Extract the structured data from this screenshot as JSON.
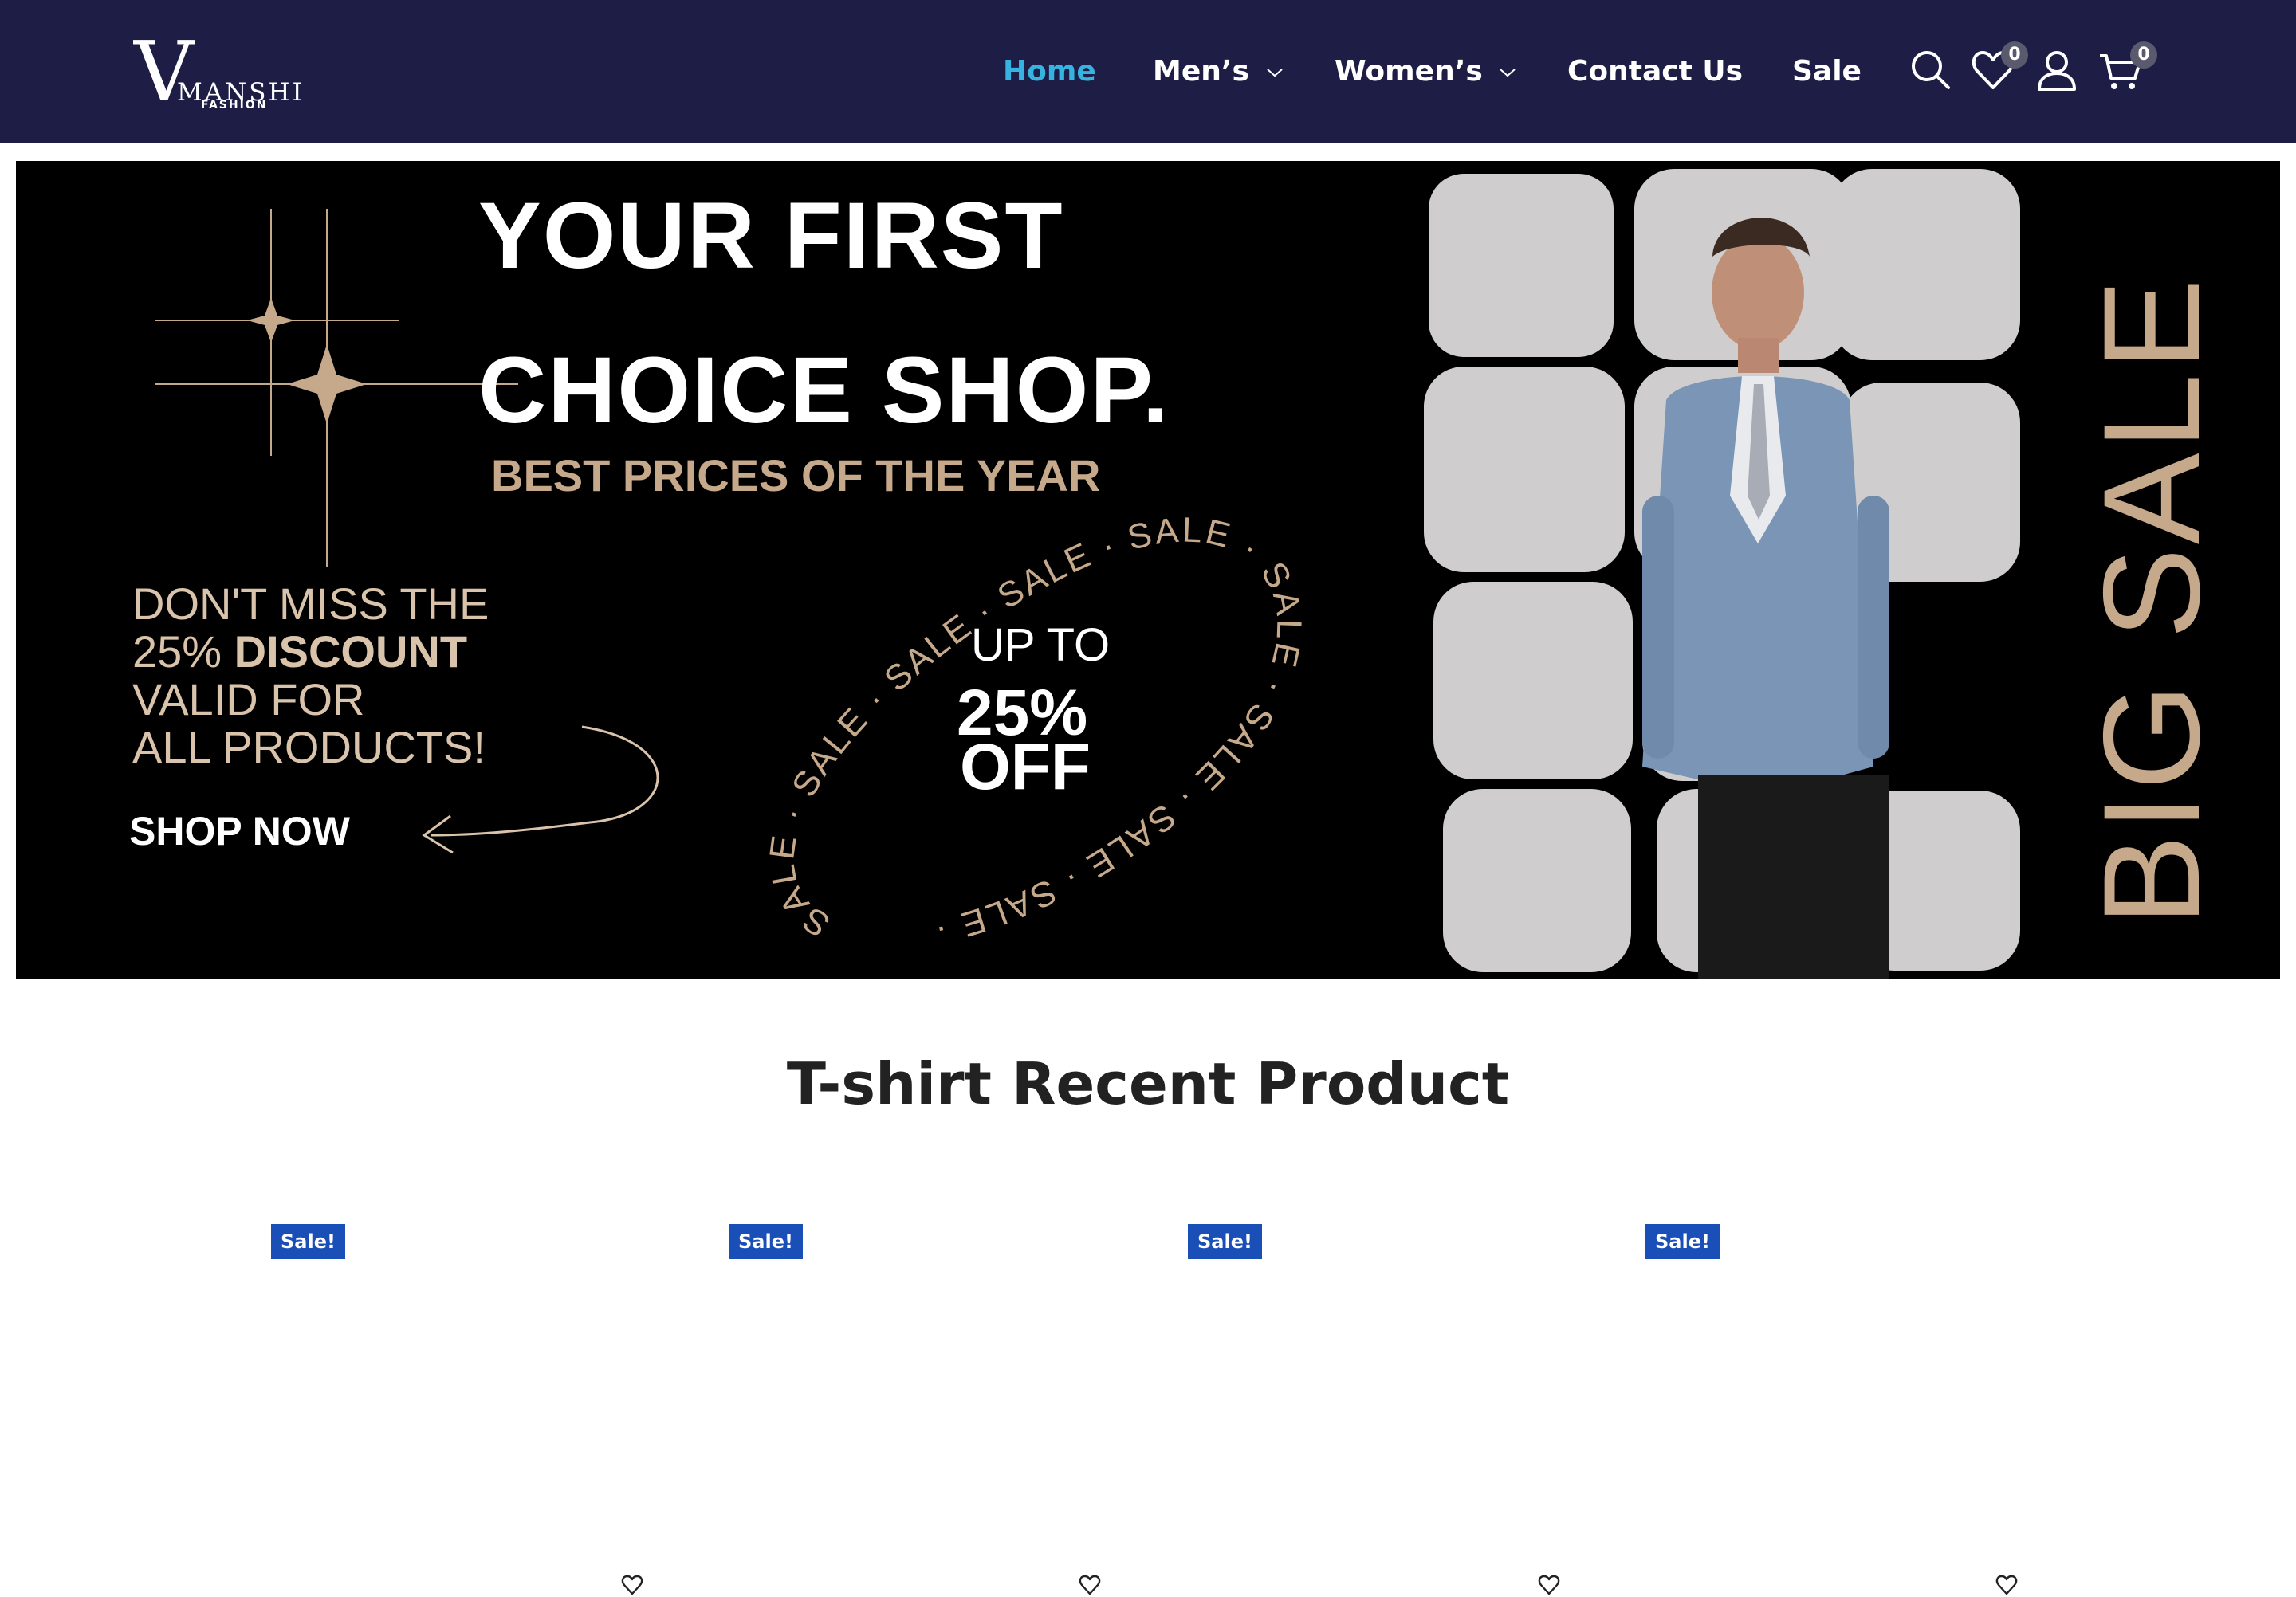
{
  "header": {
    "logo": {
      "letter": "V",
      "name": "MANSHI",
      "sub": "FASHION"
    },
    "nav": [
      {
        "label": "Home",
        "active": true
      },
      {
        "label": "Men’s",
        "dropdown": true
      },
      {
        "label": "Women’s",
        "dropdown": true
      },
      {
        "label": "Contact Us"
      },
      {
        "label": "Sale"
      }
    ],
    "wishlist_count": "0",
    "cart_count": "0",
    "icons": [
      "search-icon",
      "heart-icon",
      "user-icon",
      "cart-icon"
    ]
  },
  "banner": {
    "headline_1": "YOUR  FIRST",
    "headline_2": "CHOICE  SHOP.",
    "subline": "BEST PRICES OF THE YEAR",
    "promo_1": "DON'T MISS THE",
    "promo_2a": "25% ",
    "promo_2b": "DISCOUNT",
    "promo_3": "VALID FOR",
    "promo_4": "ALL PRODUCTS!",
    "cta": "SHOP NOW",
    "ring_text": "SALE · SALE · SALE · SALE · SALE · SALE · SALE · SALE · SALE · ",
    "offer_1": "UP TO",
    "offer_2": "25%",
    "offer_3": "OFF",
    "side_text": "BIG SALE"
  },
  "colors": {
    "header_bg": "#1d1d45",
    "nav_active": "#36b3e0",
    "accent_tan": "#c6a88a",
    "sale_badge": "#1b4fb8"
  },
  "section": {
    "title": "T-shirt Recent Product",
    "products": [
      {
        "badge": "Sale!"
      },
      {
        "badge": "Sale!"
      },
      {
        "badge": "Sale!"
      },
      {
        "badge": "Sale!"
      }
    ]
  }
}
